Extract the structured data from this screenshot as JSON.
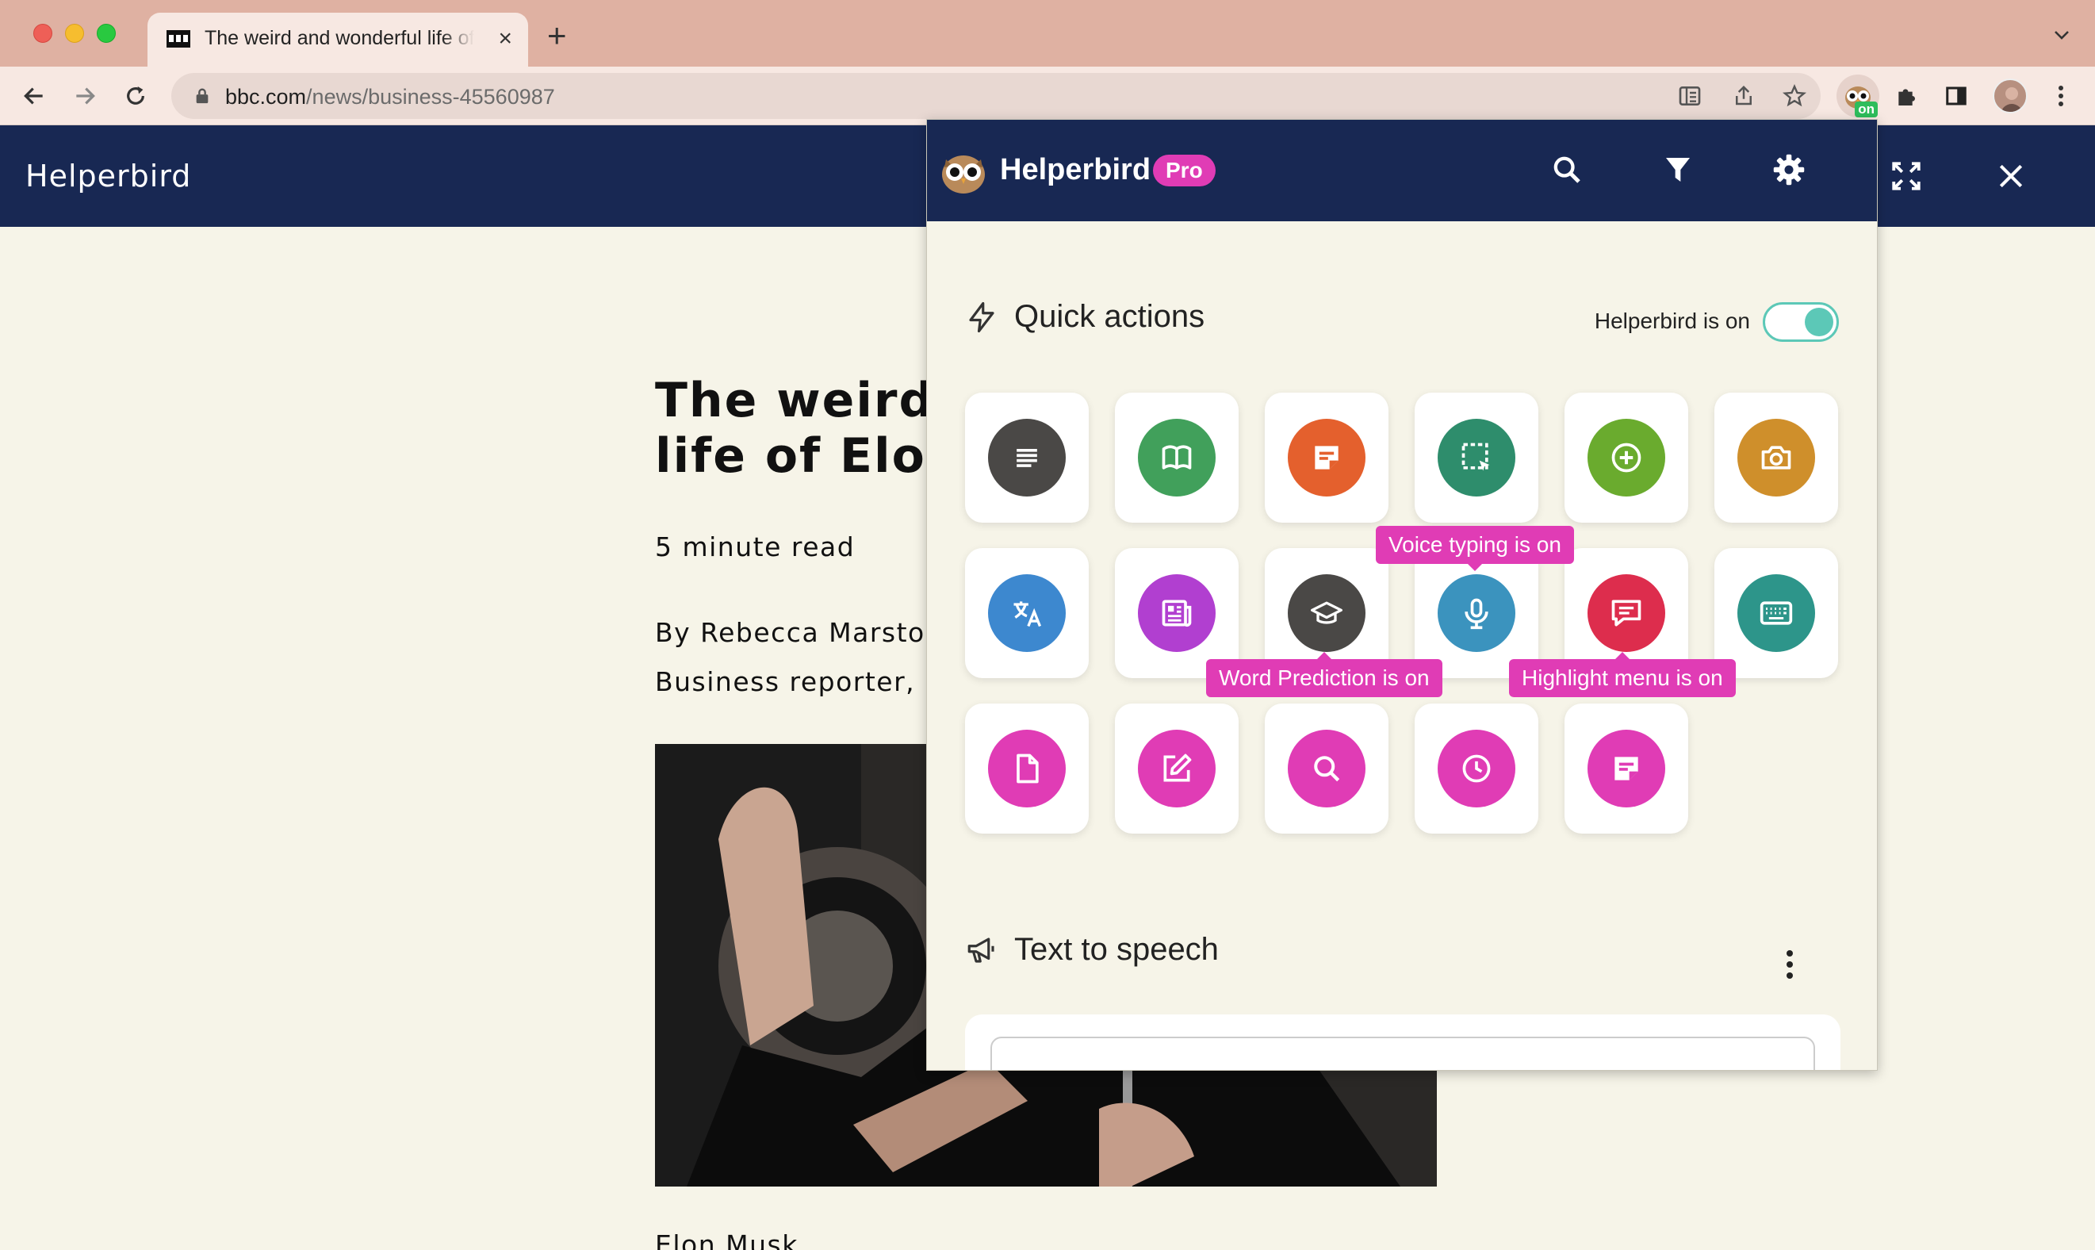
{
  "browser": {
    "tab_title": "The weird and wonderful life of Elon Musk",
    "url_domain": "bbc.com",
    "url_path": "/news/business-45560987",
    "extension_badge": "on"
  },
  "site": {
    "title": "Helperbird"
  },
  "article": {
    "headline": "The weird and wonderful life of Elon Musk",
    "read_time": "5 minute read",
    "byline": "By Rebecca Marston",
    "role": "Business reporter, BBC News",
    "caption": "Elon Musk"
  },
  "panel": {
    "brand": "Helperbird",
    "badge": "Pro",
    "quick_actions_title": "Quick actions",
    "toggle_label": "Helperbird is on",
    "toggle_on": true,
    "tts_title": "Text to speech",
    "tooltips": {
      "voice_typing": "Voice typing is on",
      "word_prediction": "Word Prediction is on",
      "highlight_menu": "Highlight menu is on"
    },
    "actions": [
      {
        "icon": "lines-icon",
        "color": "#4a4846"
      },
      {
        "icon": "book-icon",
        "color": "#41a05b"
      },
      {
        "icon": "sticky-note-icon",
        "color": "#e4602d"
      },
      {
        "icon": "selection-icon",
        "color": "#2e8d6c"
      },
      {
        "icon": "plus-circle-icon",
        "color": "#6aab2e"
      },
      {
        "icon": "camera-icon",
        "color": "#cf8f2b"
      },
      {
        "icon": "translate-icon",
        "color": "#3d88cf"
      },
      {
        "icon": "newspaper-icon",
        "color": "#b13fd0"
      },
      {
        "icon": "graduation-cap-icon",
        "color": "#4a4846"
      },
      {
        "icon": "microphone-icon",
        "color": "#3b93be"
      },
      {
        "icon": "comment-icon",
        "color": "#dd2d4d"
      },
      {
        "icon": "keyboard-icon",
        "color": "#2d958a"
      },
      {
        "icon": "file-icon",
        "color": "#e03cb5"
      },
      {
        "icon": "edit-icon",
        "color": "#e03cb5"
      },
      {
        "icon": "search-icon",
        "color": "#e03cb5"
      },
      {
        "icon": "clock-icon",
        "color": "#e03cb5"
      },
      {
        "icon": "sticky-note-icon",
        "color": "#e03cb5"
      }
    ]
  }
}
